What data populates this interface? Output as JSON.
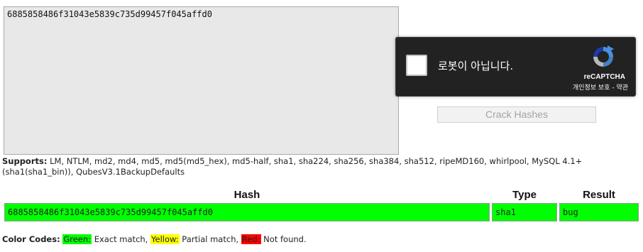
{
  "input": {
    "value": "6885858486f31043e5839c735d99457f045affd0"
  },
  "recaptcha": {
    "label": "로봇이 아닙니다.",
    "brand": "reCAPTCHA",
    "privacy_label": "개인정보 보호",
    "separator": " - ",
    "terms_label": "약관"
  },
  "crack_button": {
    "label": "Crack Hashes"
  },
  "supports": {
    "label": "Supports:",
    "text": "LM, NTLM, md2, md4, md5, md5(md5_hex), md5-half, sha1, sha224, sha256, sha384, sha512, ripeMD160, whirlpool, MySQL 4.1+ (sha1(sha1_bin)), QubesV3.1BackupDefaults"
  },
  "results": {
    "columns": [
      "Hash",
      "Type",
      "Result"
    ],
    "rows": [
      {
        "hash": "6885858486f31043e5839c735d99457f045affd0",
        "type": "sha1",
        "result": "bug",
        "status": "exact",
        "color": "#00ff00"
      }
    ]
  },
  "color_codes": {
    "label": "Color Codes:",
    "green": {
      "name": "Green:",
      "desc": " Exact match, ",
      "color": "#00ff00"
    },
    "yellow": {
      "name": "Yellow:",
      "desc": " Partial match, ",
      "color": "#ffff00"
    },
    "red": {
      "name": "Red:",
      "desc": " Not found.",
      "color": "#ff0000"
    }
  }
}
